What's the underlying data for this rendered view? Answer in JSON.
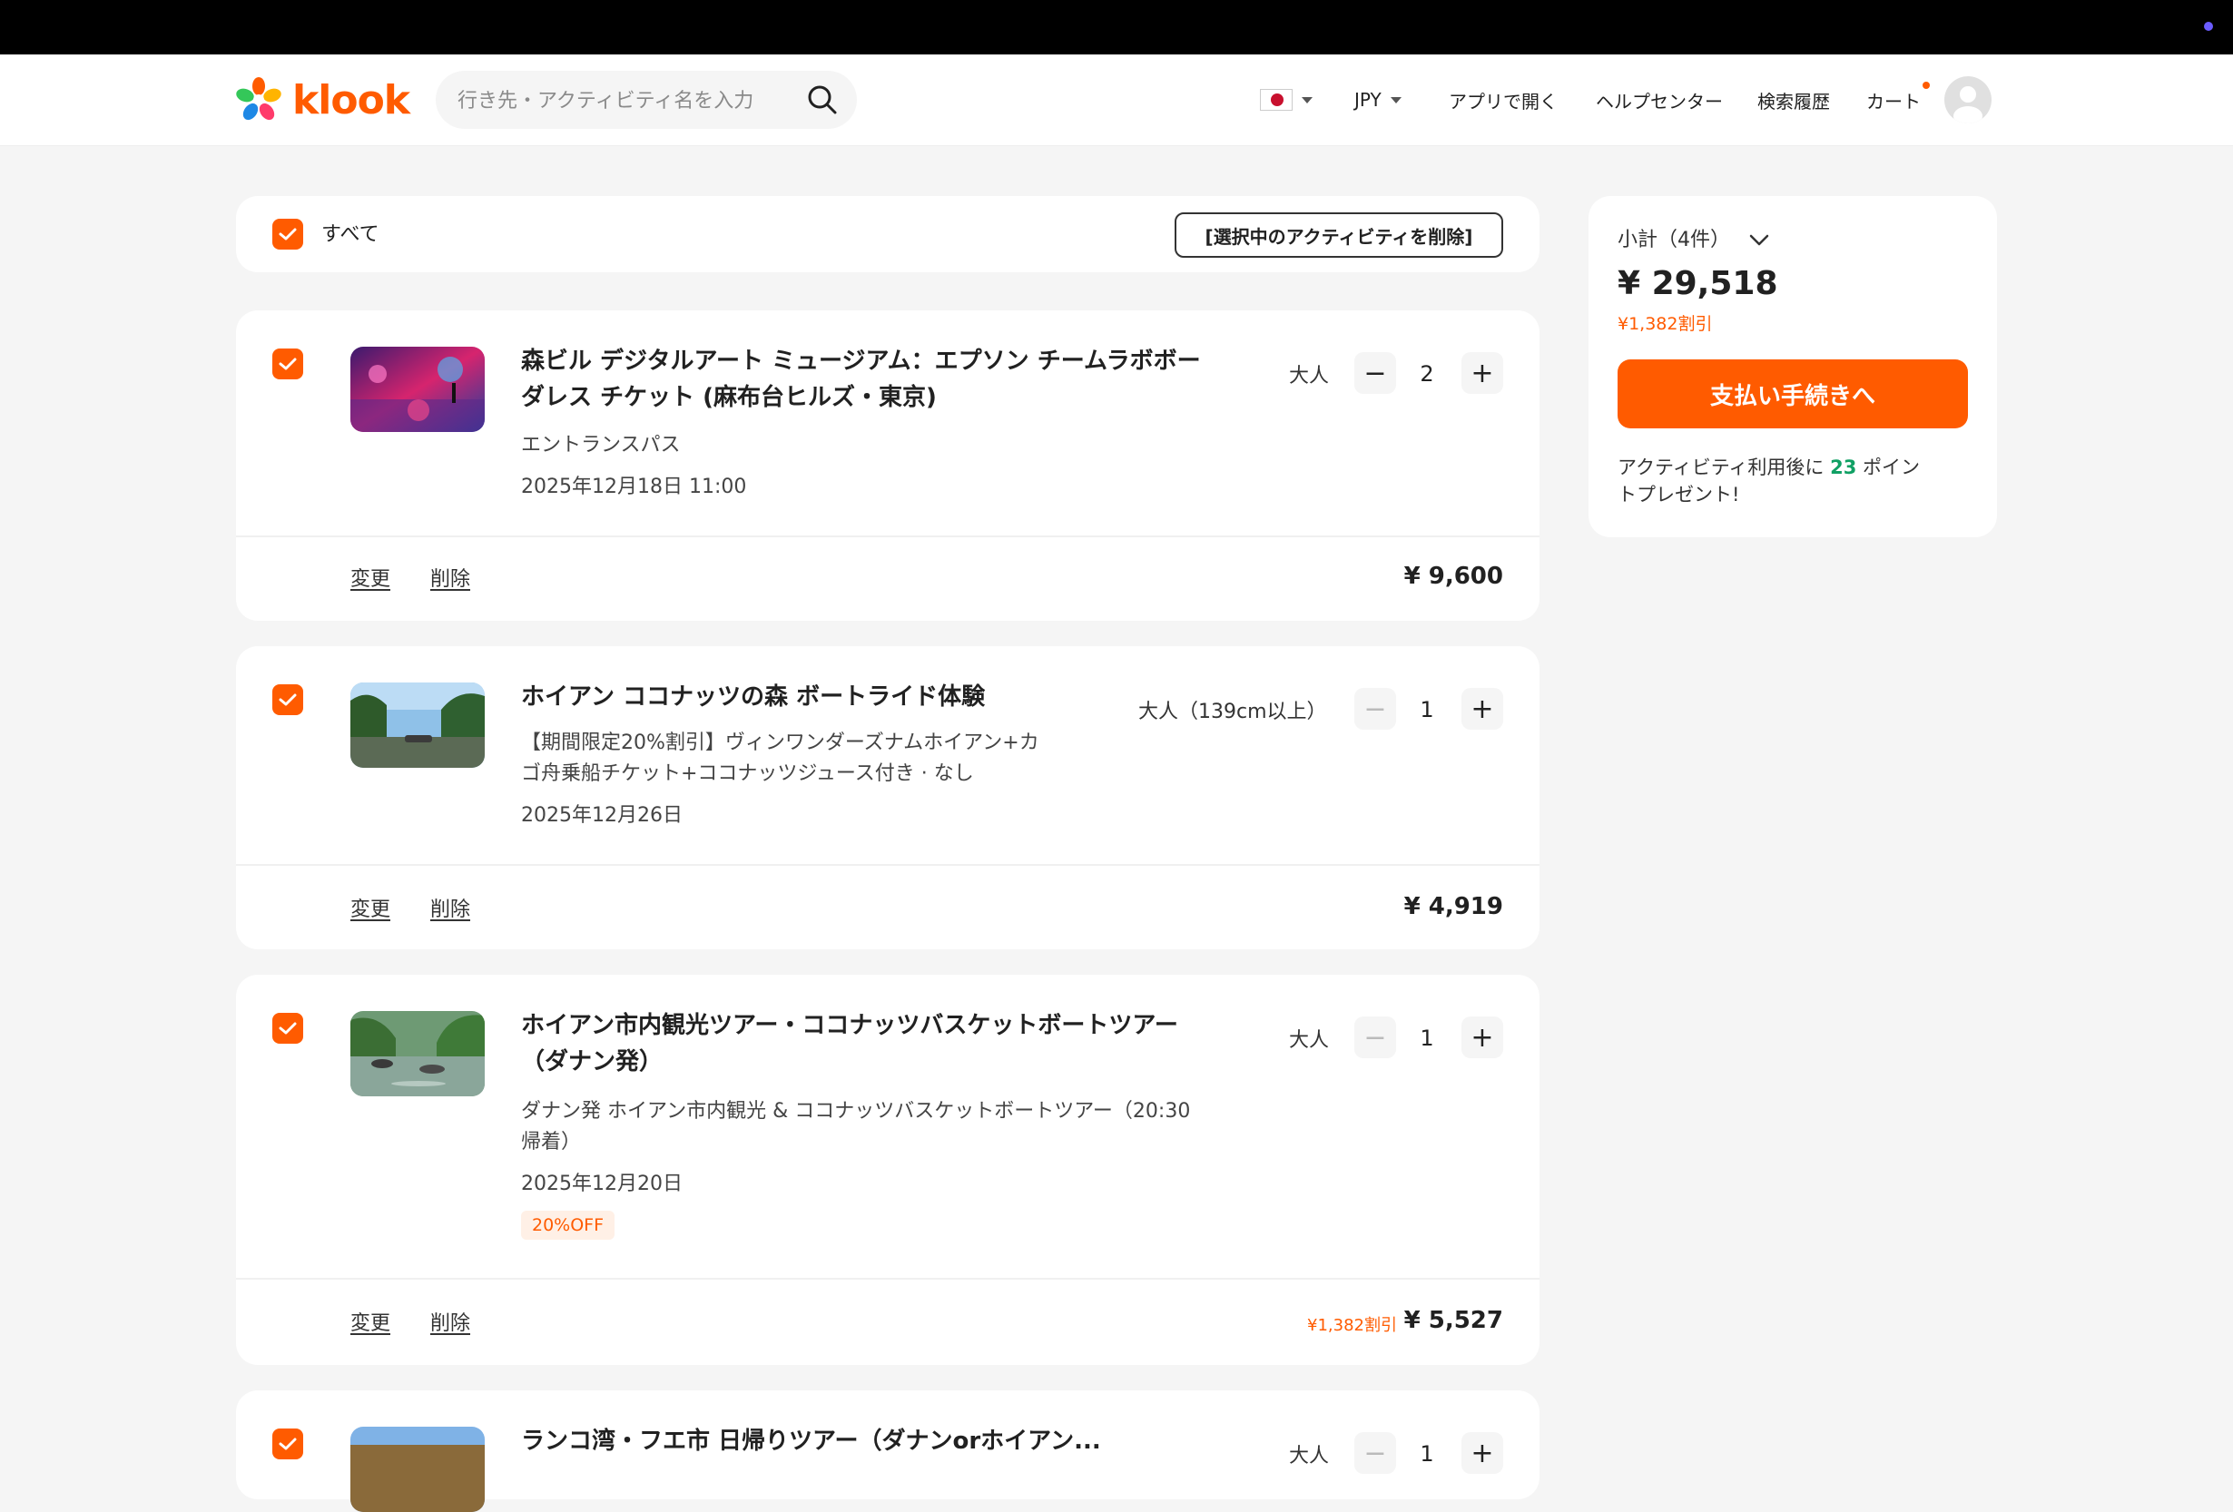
{
  "header": {
    "brand": "klook",
    "search_placeholder": "行き先・アクティビティ名を入力",
    "currency": "JPY",
    "open_app": "アプリで開く",
    "help_center": "ヘルプセンター",
    "search_history": "検索履歴",
    "cart": "カート"
  },
  "cart": {
    "select_all_label": "すべて",
    "delete_selected": "[選択中のアクティビティを削除]",
    "items": [
      {
        "title_line1": "森ビル デジタルアート ミュージアム：エプソン チームラボボー",
        "title_line2": "ダレス チケット (麻布台ヒルズ・東京)",
        "package": "エントランスパス",
        "date": "2025年12月18日 11:00",
        "qty_label": "大人",
        "qty": "2",
        "change": "変更",
        "delete": "削除",
        "price": "¥ 9,600"
      },
      {
        "title_line1": "ホイアン ココナッツの森 ボートライド体験",
        "package_line1": "【期間限定20%割引】ヴィンワンダーズナムホイアン+カ",
        "package_line2": "ゴ舟乗船チケット+ココナッツジュース付き · なし",
        "date": "2025年12月26日",
        "qty_label": "大人（139cm以上）",
        "qty": "1",
        "change": "変更",
        "delete": "削除",
        "price": "¥ 4,919"
      },
      {
        "title_line1": "ホイアン市内観光ツアー・ココナッツバスケットボートツアー",
        "title_line2": "（ダナン発）",
        "package_line1": "ダナン発 ホイアン市内観光 & ココナッツバスケットボートツアー（20:30",
        "package_line2": "帰着）",
        "date": "2025年12月20日",
        "badge": "20%OFF",
        "qty_label": "大人",
        "qty": "1",
        "change": "変更",
        "delete": "削除",
        "discount": "¥1,382割引",
        "price": "¥ 5,527"
      },
      {
        "title_line1": "ランコ湾・フエ市 日帰りツアー（ダナンorホイアン...",
        "qty_label": "大人",
        "qty": "1"
      }
    ]
  },
  "summary": {
    "subtotal_label": "小計（4件）",
    "total": "¥ 29,518",
    "discount": "¥1,382割引",
    "checkout_button": "支払い手続きへ",
    "points_prefix": "アクティビティ利用後に",
    "points_value": "23",
    "points_suffix_line1": "ポイン",
    "points_suffix_line2": "トプレゼント!"
  },
  "colors": {
    "accent": "#ff5b00",
    "points_green": "#10a064"
  }
}
